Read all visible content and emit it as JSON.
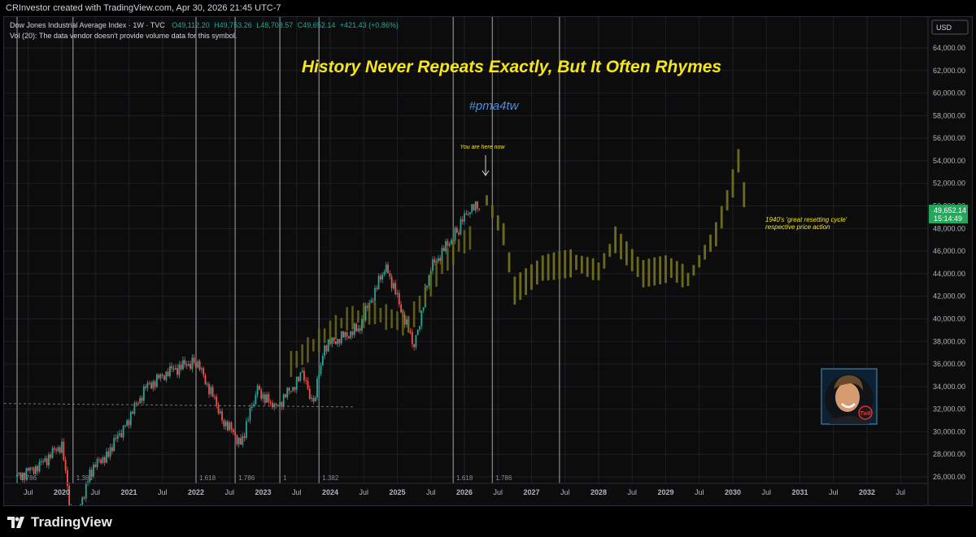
{
  "header": {
    "created_by": "CRInvestor created with TradingView.com, Apr 30, 2026 21:45 UTC-7"
  },
  "legend": {
    "symbol": "Dow Jones Industrial Average Index · 1W · TVC",
    "open": "O49,112.20",
    "high": "H49,753.26",
    "low": "L48,708.57",
    "close": "C49,652.14",
    "change": "+421.43 (+0.86%)",
    "volume_note": "Vol (20): The data vendor doesn't provide volume data for this symbol."
  },
  "annotations": {
    "headline": "History Never Repeats Exactly, But It Often Rhymes",
    "hashtag": "#pma4tw",
    "you_are_here": "You are here now",
    "cycle_note_1": "1940's 'great resetting cycle'",
    "cycle_note_2": "respective price action",
    "avatar_badge": "Tw8"
  },
  "price_axis": {
    "currency": "USD",
    "current_price": "49,652.14",
    "countdown": "15:14:49",
    "ticks": [
      "64,000.00",
      "62,000.00",
      "60,000.00",
      "58,000.00",
      "56,000.00",
      "54,000.00",
      "52,000.00",
      "50,000.00",
      "48,000.00",
      "46,000.00",
      "44,000.00",
      "42,000.00",
      "40,000.00",
      "38,000.00",
      "36,000.00",
      "34,000.00",
      "32,000.00",
      "30,000.00",
      "28,000.00",
      "26,000.00"
    ]
  },
  "time_axis": {
    "labels": [
      "Jul",
      "2020",
      "Jul",
      "2021",
      "Jul",
      "2022",
      "Jul",
      "2023",
      "Jul",
      "2024",
      "Jul",
      "2025",
      "Jul",
      "2026",
      "Jul",
      "2027",
      "Jul",
      "2028",
      "Jul",
      "2029",
      "Jul",
      "2030",
      "Jul",
      "2031",
      "Jul",
      "2032",
      "Jul"
    ]
  },
  "fib_labels": [
    "1.786",
    "1.382",
    "1.618",
    "1.786",
    "1",
    "1.382",
    "1.618",
    "1.786"
  ],
  "brand": {
    "name": "TradingView"
  },
  "colors": {
    "background": "#0c0c0c",
    "up": "#26a69a",
    "down": "#ef5350",
    "projection": "#6b6a1e",
    "headline": "#f5e51b",
    "hashtag": "#4d8fd6",
    "price_tag": "#26a65b"
  },
  "chart_data": {
    "type": "candlestick",
    "title": "Dow Jones Industrial Average Index · 1W · TVC",
    "ylabel": "USD",
    "ylim": [
      25000,
      65500
    ],
    "historical_weekly_closes": [
      {
        "date": "2019-05",
        "value": 26000
      },
      {
        "date": "2019-09",
        "value": 27000
      },
      {
        "date": "2020-01",
        "value": 28900
      },
      {
        "date": "2020-03",
        "value": 21000
      },
      {
        "date": "2020-06",
        "value": 26500
      },
      {
        "date": "2020-09",
        "value": 28000
      },
      {
        "date": "2020-12",
        "value": 30300
      },
      {
        "date": "2021-04",
        "value": 33900
      },
      {
        "date": "2021-08",
        "value": 35300
      },
      {
        "date": "2022-01",
        "value": 36300
      },
      {
        "date": "2022-06",
        "value": 31000
      },
      {
        "date": "2022-09",
        "value": 29000
      },
      {
        "date": "2022-12",
        "value": 33800
      },
      {
        "date": "2023-03",
        "value": 32000
      },
      {
        "date": "2023-08",
        "value": 35000
      },
      {
        "date": "2023-10",
        "value": 32500
      },
      {
        "date": "2023-12",
        "value": 37600
      },
      {
        "date": "2024-06",
        "value": 39100
      },
      {
        "date": "2024-11",
        "value": 44700
      },
      {
        "date": "2025-04",
        "value": 37500
      },
      {
        "date": "2025-07",
        "value": 44500
      },
      {
        "date": "2025-12",
        "value": 48000
      },
      {
        "date": "2026-02",
        "value": 50000
      },
      {
        "date": "2026-04",
        "value": 49652
      }
    ],
    "projection_1940s_analog": [
      {
        "date": "2026-05",
        "value": 50500
      },
      {
        "date": "2026-08",
        "value": 47500
      },
      {
        "date": "2026-10",
        "value": 42500
      },
      {
        "date": "2027-03",
        "value": 44500
      },
      {
        "date": "2027-09",
        "value": 45000
      },
      {
        "date": "2028-01",
        "value": 44200
      },
      {
        "date": "2028-04",
        "value": 47000
      },
      {
        "date": "2028-09",
        "value": 44000
      },
      {
        "date": "2029-02",
        "value": 44500
      },
      {
        "date": "2029-05",
        "value": 43500
      },
      {
        "date": "2029-10",
        "value": 47500
      },
      {
        "date": "2030-01",
        "value": 52000
      },
      {
        "date": "2030-02",
        "value": 54000
      },
      {
        "date": "2030-04",
        "value": 48000
      }
    ],
    "vertical_cycle_markers": [
      "2019-05",
      "2020-03",
      "2022-01",
      "2022-08",
      "2023-04",
      "2023-11",
      "2025-11",
      "2026-06",
      "2027-06"
    ]
  }
}
